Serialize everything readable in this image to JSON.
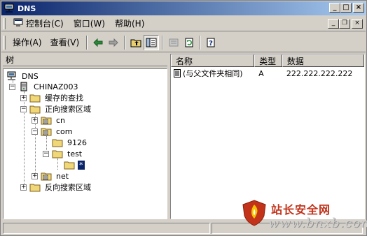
{
  "window": {
    "title": "DNS"
  },
  "menu": {
    "items": [
      "控制台(C)",
      "窗口(W)",
      "帮助(H)"
    ]
  },
  "toolbar": {
    "action_label": "操作(A)",
    "view_label": "查看(V)",
    "icons": [
      "back-icon",
      "forward-icon",
      "up-one-level-icon",
      "show-hide-tree-icon",
      "properties-icon",
      "refresh-icon",
      "help-icon"
    ]
  },
  "tree": {
    "header": "树",
    "nodes": [
      {
        "label": "DNS",
        "icon": "dns-icon",
        "level": 0
      },
      {
        "label": "CHINAZ003",
        "icon": "server-icon",
        "level": 1
      },
      {
        "label": "缓存的查找",
        "icon": "folder-icon",
        "level": 2
      },
      {
        "label": "正向搜索区域",
        "icon": "folder-icon",
        "level": 2
      },
      {
        "label": "cn",
        "icon": "zone-icon",
        "level": 3
      },
      {
        "label": "com",
        "icon": "zone-icon",
        "level": 3
      },
      {
        "label": "9126",
        "icon": "folder-icon",
        "level": 4
      },
      {
        "label": "test",
        "icon": "folder-icon",
        "level": 4
      },
      {
        "label": "*",
        "icon": "folder-icon",
        "level": 5,
        "selected": true
      },
      {
        "label": "net",
        "icon": "zone-icon",
        "level": 3
      },
      {
        "label": "反向搜索区域",
        "icon": "folder-icon",
        "level": 2
      }
    ]
  },
  "list": {
    "columns": [
      "名称",
      "类型",
      "数据"
    ],
    "rows": [
      {
        "name": "(与父文件夹相同)",
        "type": "A",
        "data": "222.222.222.222"
      }
    ]
  },
  "watermark": {
    "name": "站长安全网",
    "url": "www.bnxb.com"
  },
  "colors": {
    "titlebar_start": "#0a246a",
    "titlebar_end": "#a6caf0",
    "face": "#d4d0c8",
    "watermark_red": "#c2331a"
  }
}
